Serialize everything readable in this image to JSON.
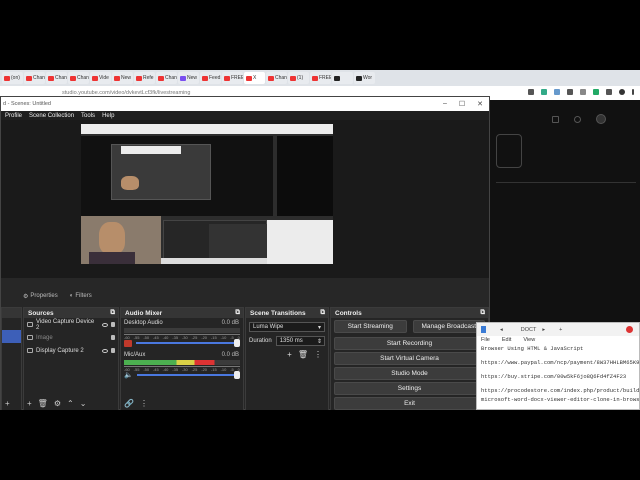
{
  "browser": {
    "tabs": [
      {
        "label": "(on)",
        "fav": "r"
      },
      {
        "label": "Chan",
        "fav": "r"
      },
      {
        "label": "Chan",
        "fav": "r"
      },
      {
        "label": "Chan",
        "fav": "r"
      },
      {
        "label": "Vide",
        "fav": "r"
      },
      {
        "label": "New",
        "fav": "r"
      },
      {
        "label": "Refe",
        "fav": "r"
      },
      {
        "label": "Chan",
        "fav": "r"
      },
      {
        "label": "New",
        "fav": "b"
      },
      {
        "label": "Feed",
        "fav": "r"
      },
      {
        "label": "FREE",
        "fav": "r"
      },
      {
        "label": "X",
        "fav": "r",
        "active": true
      },
      {
        "label": "Chan",
        "fav": "r"
      },
      {
        "label": "(1)",
        "fav": "r"
      },
      {
        "label": "FREE",
        "fav": "r"
      },
      {
        "label": "",
        "fav": "g"
      },
      {
        "label": "Wor",
        "fav": "g"
      }
    ],
    "url": "studio.youtube.com/video/dvkevtLcf3fk/livestreaming"
  },
  "obs": {
    "title": "d - Scenes: Untitled",
    "menu": [
      "Profile",
      "Scene Collection",
      "Tools",
      "Help"
    ],
    "dock_tabs": [
      "Properties",
      "Filters"
    ],
    "sources": {
      "header": "Sources",
      "items": [
        {
          "label": "Video Capture Device 2"
        },
        {
          "label": "Image"
        },
        {
          "label": "Display Capture 2"
        }
      ]
    },
    "audio_mixer": {
      "header": "Audio Mixer",
      "channels": [
        {
          "label": "Desktop Audio",
          "db": "0.0 dB",
          "level": 0
        },
        {
          "label": "Mic/Aux",
          "db": "0.0 dB",
          "level": 0.78
        }
      ],
      "tick_labels": [
        "-60",
        "-55",
        "-50",
        "-45",
        "-40",
        "-35",
        "-30",
        "-25",
        "-20",
        "-15",
        "-10",
        "-5",
        "0"
      ]
    },
    "scene_transitions": {
      "header": "Scene Transitions",
      "transition": "Luma Wipe",
      "duration_label": "Duration",
      "duration_value": "1350 ms"
    },
    "controls": {
      "header": "Controls",
      "start_streaming": "Start Streaming",
      "manage_broadcast": "Manage Broadcast",
      "start_recording": "Start Recording",
      "start_virtual_camera": "Start Virtual Camera",
      "studio_mode": "Studio Mode",
      "settings": "Settings",
      "exit": "Exit"
    }
  },
  "float_window": {
    "tab": "DOCT",
    "menu": [
      "File",
      "Edit",
      "View"
    ],
    "lines": [
      "Browser Using HTML & JavaScript",
      "https://www.paypal.com/ncp/payment/8W37HHLBM65K9",
      "https://buy.stripe.com/00w5kF6jo8Q6Fd4fZ4F23",
      "https://procodestore.com/index.php/product/build-a-",
      "microsoft-word-docx-viewer-editor-clone-in-browse"
    ]
  }
}
